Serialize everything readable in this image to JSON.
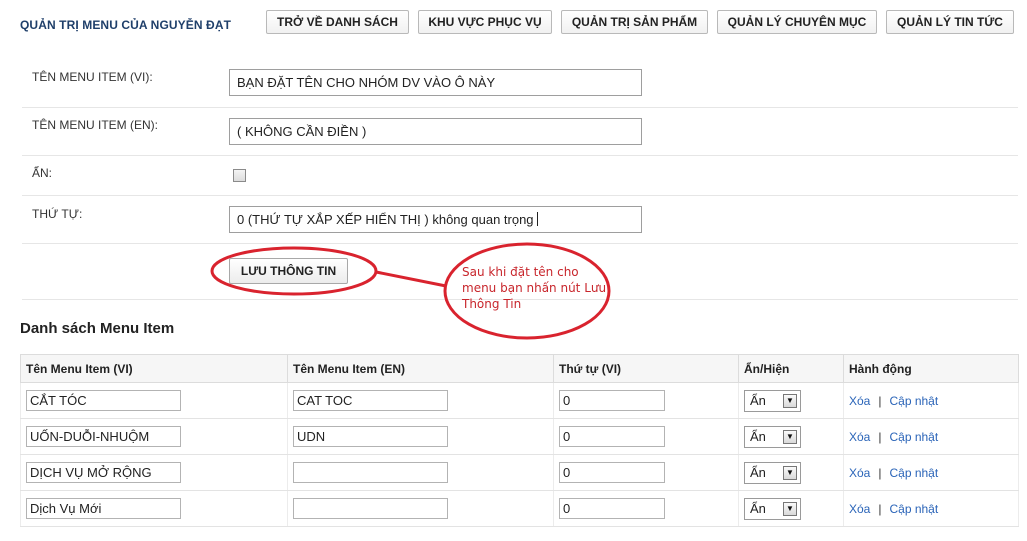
{
  "header": {
    "title": "QUẢN TRỊ MENU CỦA NGUYỄN ĐẠT",
    "nav": [
      {
        "label": "TRỞ VỀ DANH SÁCH"
      },
      {
        "label": "KHU VỰC PHỤC VỤ"
      },
      {
        "label": "QUẢN TRỊ SẢN PHẨM"
      },
      {
        "label": "QUẢN LÝ CHUYÊN MỤC"
      },
      {
        "label": "QUẢN LÝ TIN TỨC"
      }
    ]
  },
  "form": {
    "name_vi_label": "TÊN MENU ITEM (VI):",
    "name_vi_value": "BẠN ĐẶT TÊN CHO NHÓM DV VÀO Ô NÀY",
    "name_en_label": "TÊN MENU ITEM (EN):",
    "name_en_value": "( KHÔNG CẦN ĐIỀN )",
    "hidden_label": "ẨN:",
    "hidden_checked": false,
    "order_label": "THỨ TỰ:",
    "order_value": "0 (THỨ TỰ XẮP XẾP HIỂN THỊ ) không quan trọng",
    "save_label": "LƯU THÔNG TIN"
  },
  "annotation": {
    "callout_text": "Sau khi đặt tên cho menu bạn nhấn nút Lưu Thông Tin",
    "color": "#d9232e"
  },
  "list": {
    "title": "Danh sách Menu Item",
    "columns": [
      "Tên Menu Item (VI)",
      "Tên Menu Item (EN)",
      "Thứ tự (VI)",
      "Ẩn/Hiện",
      "Hành động"
    ],
    "rows": [
      {
        "name_vi": "CẮT TÓC",
        "name_en": "CAT TOC",
        "order": "0",
        "visibility": "Ẩn",
        "delete": "Xóa",
        "update": "Cập nhật"
      },
      {
        "name_vi": "UỐN-DUỖI-NHUỘM",
        "name_en": "UDN",
        "order": "0",
        "visibility": "Ẩn",
        "delete": "Xóa",
        "update": "Cập nhật"
      },
      {
        "name_vi": "DỊCH VỤ MỞ RỘNG",
        "name_en": "",
        "order": "0",
        "visibility": "Ẩn",
        "delete": "Xóa",
        "update": "Cập nhật"
      },
      {
        "name_vi": "Dịch Vụ Mới",
        "name_en": "",
        "order": "0",
        "visibility": "Ẩn",
        "delete": "Xóa",
        "update": "Cập nhật"
      }
    ]
  }
}
